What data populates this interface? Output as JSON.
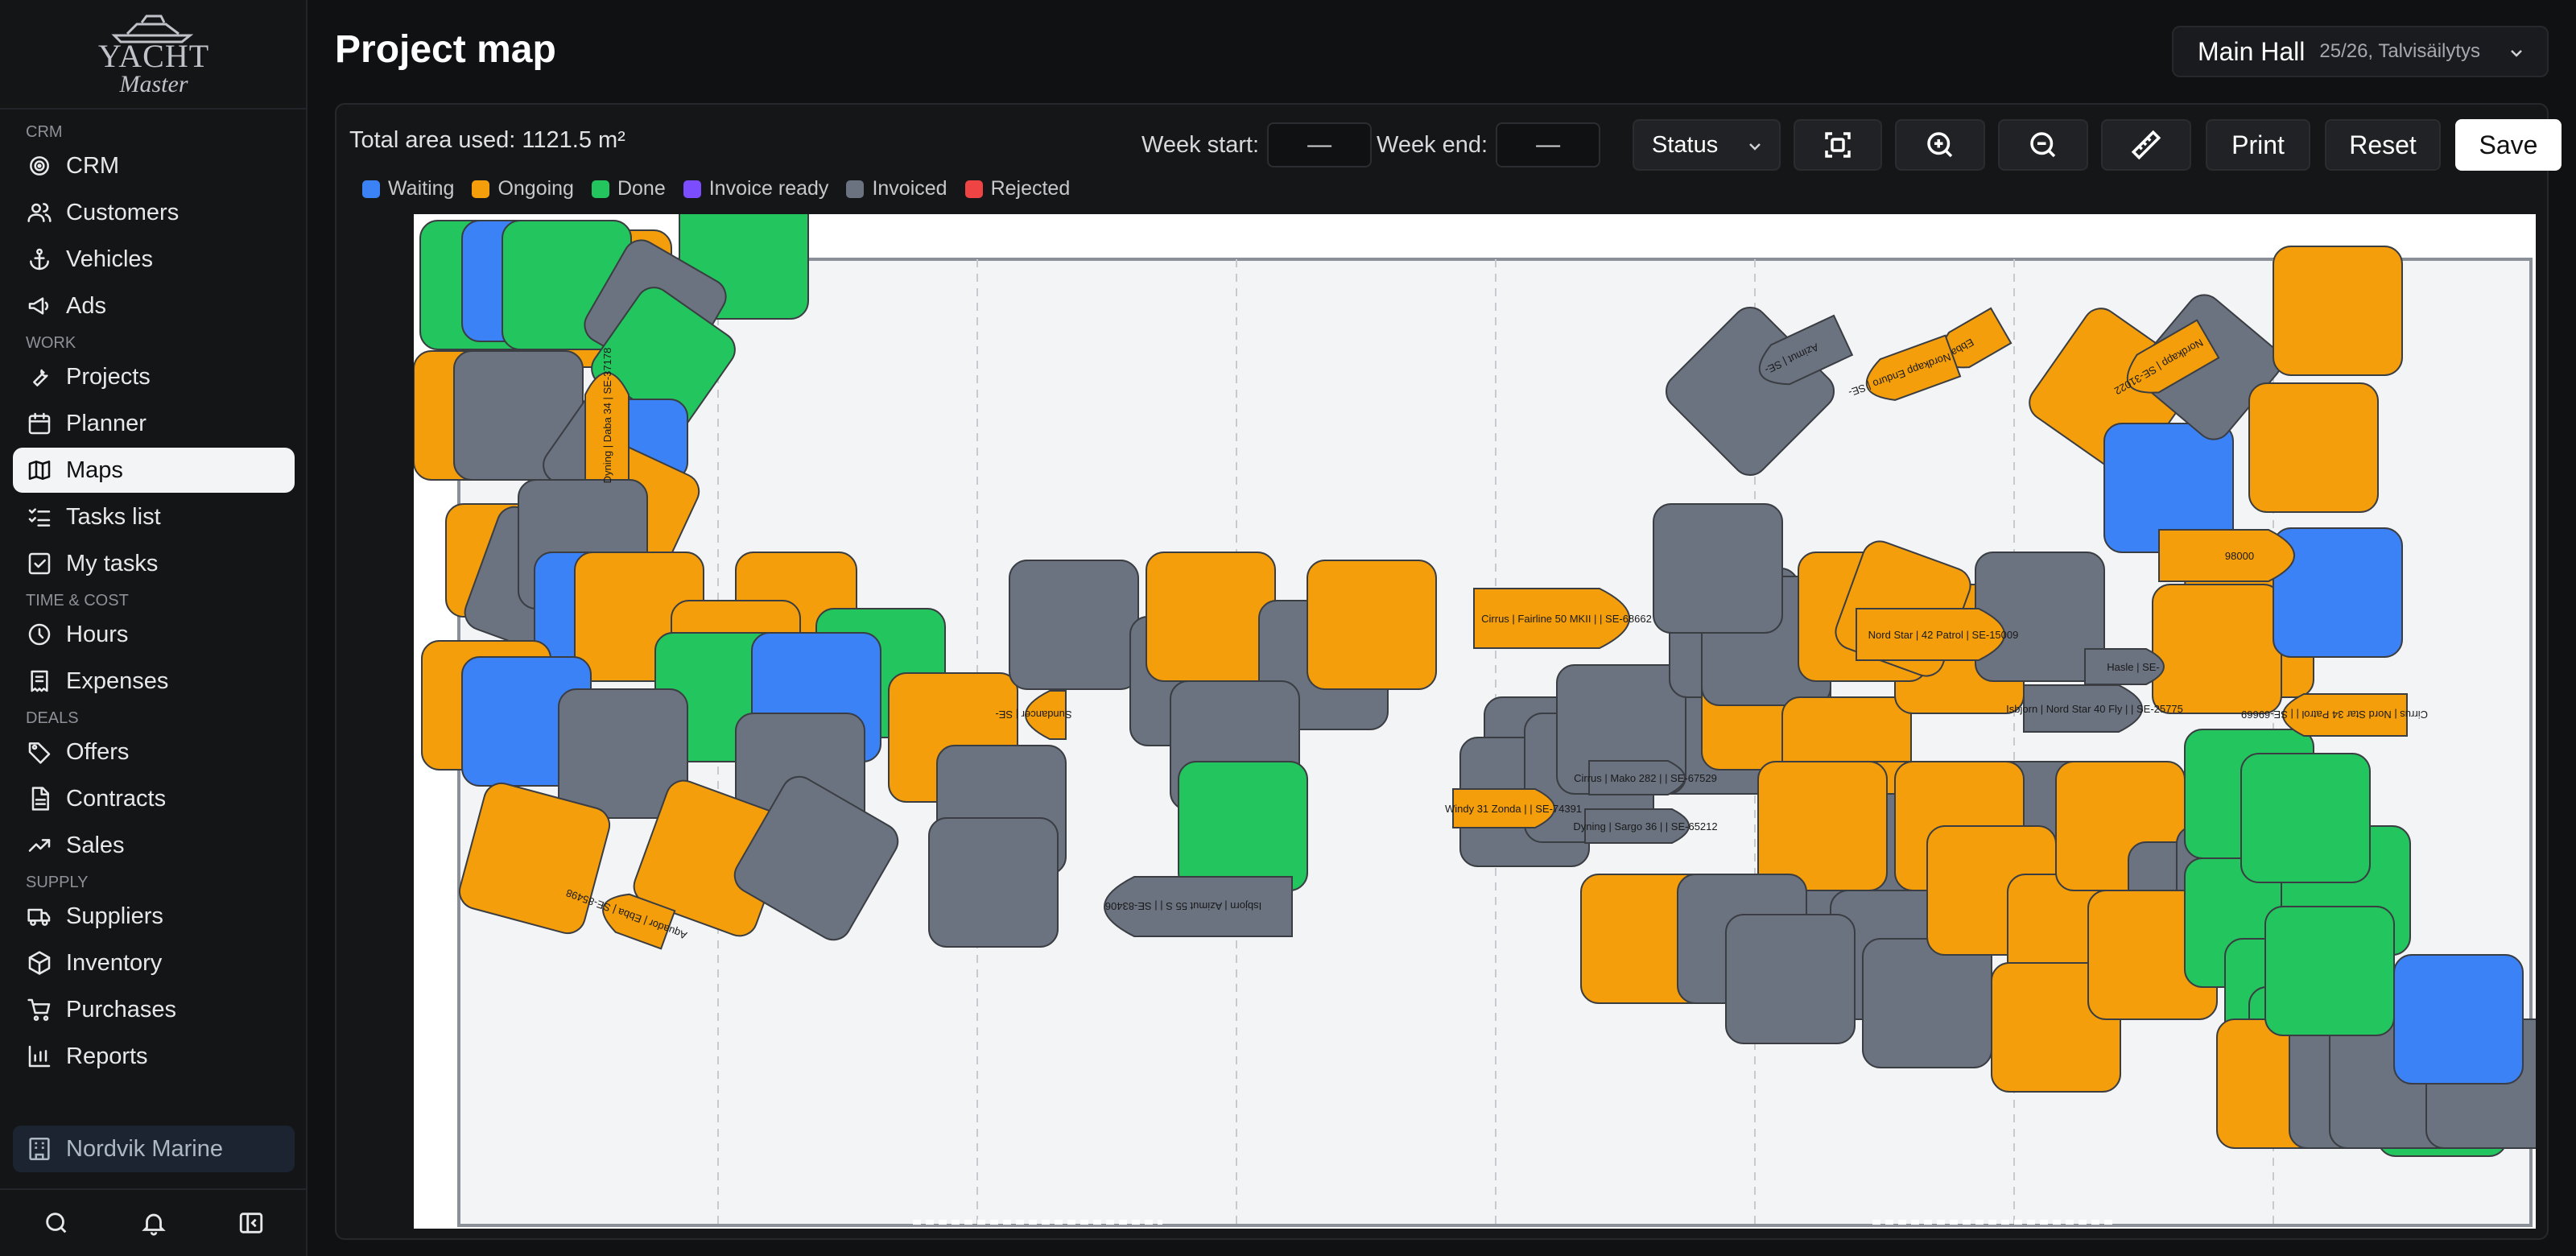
{
  "logo": {
    "line1": "YACHT",
    "line2": "Master"
  },
  "sidebar": {
    "sections": [
      {
        "title": "CRM",
        "items": [
          {
            "label": "CRM",
            "icon": "target-icon"
          },
          {
            "label": "Customers",
            "icon": "users-icon"
          },
          {
            "label": "Vehicles",
            "icon": "anchor-icon"
          },
          {
            "label": "Ads",
            "icon": "megaphone-icon"
          }
        ]
      },
      {
        "title": "WORK",
        "items": [
          {
            "label": "Projects",
            "icon": "wrench-icon"
          },
          {
            "label": "Planner",
            "icon": "calendar-icon"
          },
          {
            "label": "Maps",
            "icon": "map-icon",
            "active": true
          },
          {
            "label": "Tasks list",
            "icon": "list-checks-icon"
          },
          {
            "label": "My tasks",
            "icon": "square-check-icon"
          }
        ]
      },
      {
        "title": "TIME & COST",
        "items": [
          {
            "label": "Hours",
            "icon": "clock-icon"
          },
          {
            "label": "Expenses",
            "icon": "receipt-icon"
          }
        ]
      },
      {
        "title": "DEALS",
        "items": [
          {
            "label": "Offers",
            "icon": "tag-icon"
          },
          {
            "label": "Contracts",
            "icon": "file-icon"
          },
          {
            "label": "Sales",
            "icon": "trending-up-icon"
          }
        ]
      },
      {
        "title": "SUPPLY",
        "items": [
          {
            "label": "Suppliers",
            "icon": "truck-icon"
          },
          {
            "label": "Inventory",
            "icon": "package-icon"
          },
          {
            "label": "Purchases",
            "icon": "cart-icon"
          },
          {
            "label": "Reports",
            "icon": "bar-chart-icon"
          }
        ]
      }
    ],
    "org": "Nordvik Marine"
  },
  "header": {
    "title": "Project map",
    "hall_name": "Main Hall",
    "hall_season": "25/26, Talvisäilytys"
  },
  "toolbar": {
    "area_label": "Total area used: 1121.5 m²",
    "week_start_label": "Week start:",
    "week_start_value": "—",
    "week_end_label": "Week end:",
    "week_end_value": "—",
    "status_label": "Status",
    "print_label": "Print",
    "reset_label": "Reset",
    "save_label": "Save"
  },
  "legend": [
    {
      "label": "Waiting",
      "color": "#3b82f6"
    },
    {
      "label": "Ongoing",
      "color": "#f59e0b"
    },
    {
      "label": "Done",
      "color": "#22c55e"
    },
    {
      "label": "Invoice ready",
      "color": "#7c4dff"
    },
    {
      "label": "Invoiced",
      "color": "#6b7280"
    },
    {
      "label": "Rejected",
      "color": "#ef4444"
    }
  ],
  "boats": [
    {
      "label": "Dyning | Daba 34 | SE-37178",
      "status": "ongoing"
    },
    {
      "label": "Cirrus | Fairline 50 MKII | | SE-68662",
      "status": "ongoing"
    },
    {
      "label": "Nord Star | 42 Patrol | SE-15009",
      "status": "ongoing"
    },
    {
      "label": "Isbjorn | Nord Star 40 Fly | | SE-25775",
      "status": "invoiced"
    },
    {
      "label": "Cirrus | Nord Star 34 Patrol | | SE-69669",
      "status": "ongoing"
    },
    {
      "label": "Windy 31 Zonda | | SE-74391",
      "status": "ongoing"
    },
    {
      "label": "Cirrus | Mako 282 | | SE-67529",
      "status": "invoiced"
    },
    {
      "label": "Dyning | Sargo 36 | | SE-65212",
      "status": "invoiced"
    },
    {
      "label": "Isbjorn | Azimut 55 S | | SE-83406",
      "status": "invoiced"
    },
    {
      "label": "Sundancer | SE-",
      "status": "ongoing"
    },
    {
      "label": "Ebba |",
      "status": "ongoing"
    },
    {
      "label": "98000",
      "status": "ongoing"
    },
    {
      "label": "Aquador | Ebba | SE-85498",
      "status": "ongoing"
    },
    {
      "label": "Nordkapp Enduro | SE-",
      "status": "ongoing"
    },
    {
      "label": "Ebba",
      "status": "ongoing"
    },
    {
      "label": "Azimut | SE-",
      "status": "invoiced"
    },
    {
      "label": "Nordkapp | SE-31022",
      "status": "ongoing"
    },
    {
      "label": "Hasle | SE-",
      "status": "invoiced"
    }
  ]
}
